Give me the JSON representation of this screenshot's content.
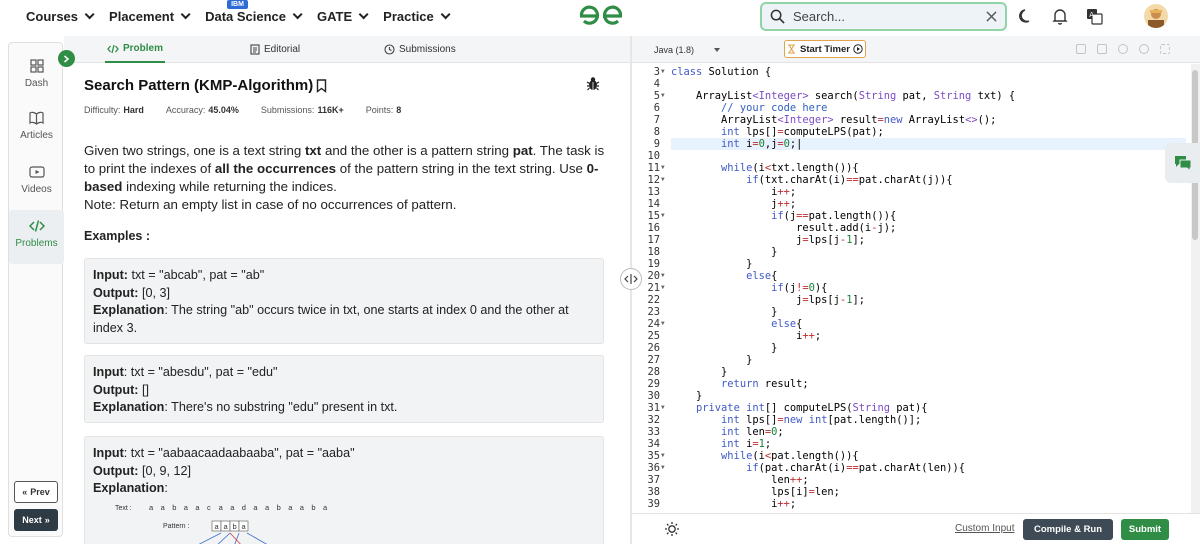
{
  "nav": {
    "items": [
      {
        "label": "Courses"
      },
      {
        "label": "Placement"
      },
      {
        "label": "Data Science",
        "badge": "IBM"
      },
      {
        "label": "GATE"
      },
      {
        "label": "Practice"
      }
    ],
    "search_placeholder": "Search...",
    "brand_color": "#2f8d46"
  },
  "rail": {
    "items": [
      {
        "label": "Dash",
        "icon": "dashboard-icon"
      },
      {
        "label": "Articles",
        "icon": "book-icon"
      },
      {
        "label": "Videos",
        "icon": "video-icon"
      },
      {
        "label": "Problems",
        "icon": "code-icon",
        "active": true
      }
    ],
    "prev_label": "Prev",
    "next_label": "Next"
  },
  "tabs": [
    {
      "label": "Problem",
      "active": true
    },
    {
      "label": "Editorial"
    },
    {
      "label": "Submissions"
    }
  ],
  "problem": {
    "title": "Search Pattern (KMP-Algorithm)",
    "meta": [
      {
        "key": "Difficulty:",
        "value": "Hard"
      },
      {
        "key": "Accuracy:",
        "value": "45.04%"
      },
      {
        "key": "Submissions:",
        "value": "116K+"
      },
      {
        "key": "Points:",
        "value": "8"
      }
    ],
    "desc_1": "Given two strings, one is a text string ",
    "desc_txt": "txt",
    "desc_2": " and the other is a pattern string ",
    "desc_pat": "pat",
    "desc_3": ". The task is to print the indexes of ",
    "desc_all": "all the occurrences",
    "desc_4": " of the pattern string in the text string. Use ",
    "desc_zero": "0-based",
    "desc_5": " indexing while returning the indices.",
    "note": "Note: Return an empty list in case of no occurrences of pattern.",
    "examples_heading": "Examples :",
    "examples": [
      {
        "input_label": "Input:",
        "input": " txt = \"abcab\", pat = \"ab\"",
        "output_label": "Output:",
        "output": " [0, 3]",
        "expl_label": "Explanation",
        "expl": ": The string \"ab\" occurs twice in txt, one starts at index 0 and the other at index 3."
      },
      {
        "input_label": "Input",
        "input": ": txt = \"abesdu\", pat = \"edu\"",
        "output_label": "Output:",
        "output": " []",
        "expl_label": "Explanation",
        "expl": ": There's no substring \"edu\" present in txt."
      },
      {
        "input_label": "Input",
        "input": ": txt = \"aabaacaadaabaaba\", pat = \"aaba\"",
        "output_label": "Output:",
        "output": " [0, 9, 12]",
        "expl_label": "Explanation",
        "expl": ":"
      }
    ],
    "diagram": {
      "text_label": "Text :",
      "text_chars": [
        "a",
        "a",
        "b",
        "a",
        "a",
        "c",
        "a",
        "a",
        "d",
        "a",
        "a",
        "b",
        "a",
        "a",
        "b",
        "a"
      ],
      "pattern_label": "Pattern :",
      "pattern_chars": [
        "a",
        "a",
        "b",
        "a"
      ]
    }
  },
  "editor": {
    "language": "Java (1.8)",
    "timer_label": "Start Timer",
    "custom_input_label": "Custom Input",
    "compile_label": "Compile & Run",
    "submit_label": "Submit",
    "lines": [
      {
        "n": "3",
        "fold": true,
        "html": "<span class=\"kw\">class</span> Solution {"
      },
      {
        "n": "4",
        "html": ""
      },
      {
        "n": "5",
        "fold": true,
        "html": "    ArrayList<span class=\"str\">&lt;Integer&gt;</span> search(<span class=\"str\">String</span> pat, <span class=\"str\">String</span> txt) {"
      },
      {
        "n": "6",
        "html": "        <span class=\"cm\">// your code here</span>"
      },
      {
        "n": "7",
        "html": "        ArrayList<span class=\"str\">&lt;Integer&gt;</span> result<span class=\"op\">=</span><span class=\"kw\">new</span> ArrayList<span class=\"str\">&lt;&gt;</span>();"
      },
      {
        "n": "8",
        "html": "        <span class=\"kw\">int</span> lps[]<span class=\"op\">=</span>computeLPS(pat);"
      },
      {
        "n": "9",
        "hl": true,
        "html": "        <span class=\"kw\">int</span> i<span class=\"op\">=</span><span class=\"num\">0</span>,j<span class=\"op\">=</span><span class=\"num\">0</span>;|"
      },
      {
        "n": "10",
        "html": ""
      },
      {
        "n": "11",
        "fold": true,
        "html": "        <span class=\"kw\">while</span>(i<span class=\"op\">&lt;</span>txt.length()){"
      },
      {
        "n": "12",
        "fold": true,
        "html": "            <span class=\"kw\">if</span>(txt.charAt(i)<span class=\"op\">==</span>pat.charAt(j)){"
      },
      {
        "n": "13",
        "html": "                i<span class=\"op\">++</span>;"
      },
      {
        "n": "14",
        "html": "                j<span class=\"op\">++</span>;"
      },
      {
        "n": "15",
        "fold": true,
        "html": "                <span class=\"kw\">if</span>(j<span class=\"op\">==</span>pat.length()){"
      },
      {
        "n": "16",
        "html": "                    result.add(i<span class=\"op\">-</span>j);"
      },
      {
        "n": "17",
        "html": "                    j<span class=\"op\">=</span>lps[j<span class=\"op\">-</span><span class=\"num\">1</span>];"
      },
      {
        "n": "18",
        "html": "                }"
      },
      {
        "n": "19",
        "html": "            }"
      },
      {
        "n": "20",
        "fold": true,
        "html": "            <span class=\"kw\">else</span>{"
      },
      {
        "n": "21",
        "fold": true,
        "html": "                <span class=\"kw\">if</span>(j<span class=\"op\">!=</span><span class=\"num\">0</span>){"
      },
      {
        "n": "22",
        "html": "                    j<span class=\"op\">=</span>lps[j<span class=\"op\">-</span><span class=\"num\">1</span>];"
      },
      {
        "n": "23",
        "html": "                }"
      },
      {
        "n": "24",
        "fold": true,
        "html": "                <span class=\"kw\">else</span>{"
      },
      {
        "n": "25",
        "html": "                    i<span class=\"op\">++</span>;"
      },
      {
        "n": "26",
        "html": "                }"
      },
      {
        "n": "27",
        "html": "            }"
      },
      {
        "n": "28",
        "html": "        }"
      },
      {
        "n": "29",
        "html": "        <span class=\"kw\">return</span> result;"
      },
      {
        "n": "30",
        "html": "    }"
      },
      {
        "n": "31",
        "fold": true,
        "html": "    <span class=\"kw\">private</span> <span class=\"kw\">int</span>[] computeLPS(<span class=\"str\">String</span> pat){"
      },
      {
        "n": "32",
        "html": "        <span class=\"kw\">int</span> lps[]<span class=\"op\">=</span><span class=\"kw\">new</span> <span class=\"kw\">int</span>[pat.length()];"
      },
      {
        "n": "33",
        "html": "        <span class=\"kw\">int</span> len<span class=\"op\">=</span><span class=\"num\">0</span>;"
      },
      {
        "n": "34",
        "html": "        <span class=\"kw\">int</span> i<span class=\"op\">=</span><span class=\"num\">1</span>;"
      },
      {
        "n": "35",
        "fold": true,
        "html": "        <span class=\"kw\">while</span>(i<span class=\"op\">&lt;</span>pat.length()){"
      },
      {
        "n": "36",
        "fold": true,
        "html": "            <span class=\"kw\">if</span>(pat.charAt(i)<span class=\"op\">==</span>pat.charAt(len)){"
      },
      {
        "n": "37",
        "html": "                len<span class=\"op\">++</span>;"
      },
      {
        "n": "38",
        "html": "                lps[i]<span class=\"op\">=</span>len;"
      },
      {
        "n": "39",
        "html": "                i<span class=\"op\">++</span>;"
      }
    ]
  }
}
